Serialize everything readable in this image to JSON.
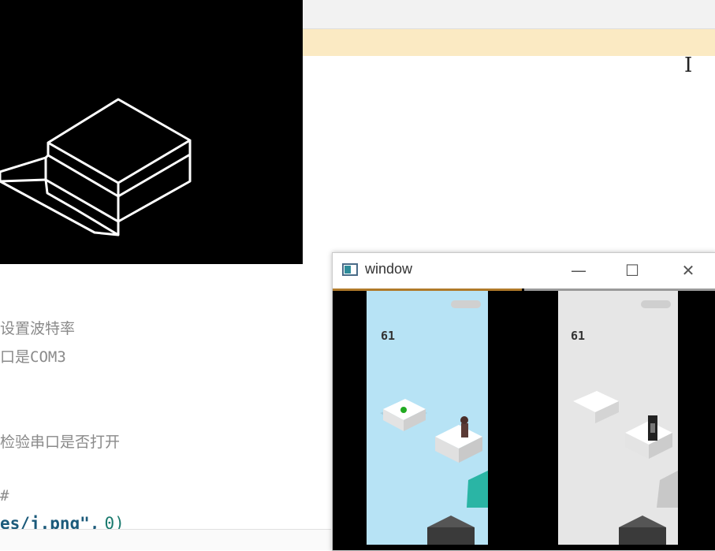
{
  "editor": {
    "code_lines": [
      {
        "text": "设置波特率"
      },
      {
        "text": "口是COM3"
      },
      {
        "text": "检验串口是否打开"
      },
      {
        "text": "#"
      },
      {
        "text_a": "es/j.png\",",
        "text_b": "0)"
      }
    ]
  },
  "window": {
    "title": "window",
    "minimize": "—",
    "maximize": "☐",
    "close": "✕",
    "frames": [
      {
        "score": "61"
      },
      {
        "score": "61"
      }
    ]
  },
  "colors": {
    "highlight": "#fbeac3",
    "sky_left": "#b7e3f5",
    "sky_right": "#e6e6e6",
    "window_border_accent": "#b07a2a"
  }
}
